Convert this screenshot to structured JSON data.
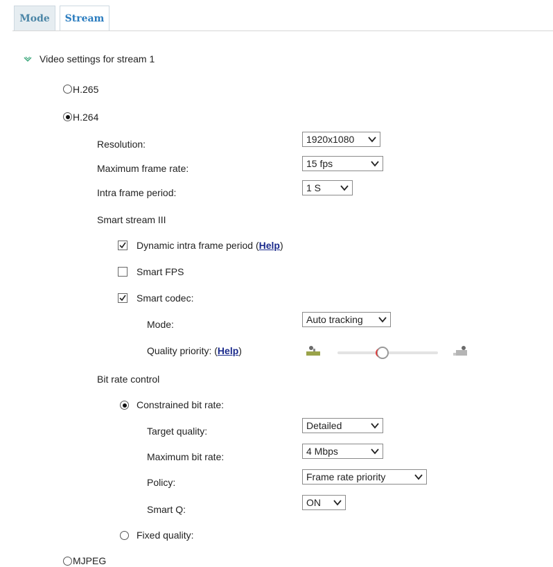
{
  "tabs": [
    {
      "label": "Mode",
      "active": false
    },
    {
      "label": "Stream",
      "active": true
    }
  ],
  "section": {
    "title": "Video settings for stream 1",
    "icon": "expand-chevron-icon"
  },
  "codecs": {
    "h265": {
      "label": "H.265",
      "selected": false
    },
    "h264": {
      "label": "H.264",
      "selected": true
    },
    "mjpeg": {
      "label": "MJPEG",
      "selected": false
    }
  },
  "h264": {
    "resolution": {
      "label": "Resolution:",
      "value": "1920x1080"
    },
    "max_frame_rate": {
      "label": "Maximum frame rate:",
      "value": "15 fps"
    },
    "intra_frame_period": {
      "label": "Intra frame period:",
      "value": "1 S"
    },
    "smart_stream": {
      "title": "Smart stream III",
      "dynamic_intra": {
        "label": "Dynamic intra frame period (",
        "help": "Help",
        "close": ")",
        "checked": true
      },
      "smart_fps": {
        "label": "Smart FPS",
        "checked": false
      },
      "smart_codec": {
        "label": "Smart codec:",
        "checked": true
      },
      "mode": {
        "label": "Mode:",
        "value": "Auto tracking"
      },
      "quality_priority": {
        "label": "Quality priority: (",
        "help": "Help",
        "close": ")",
        "level": 0.45
      }
    },
    "bit_rate_control": {
      "title": "Bit rate control",
      "constrained": {
        "label": "Constrained bit rate:",
        "selected": true
      },
      "target_quality": {
        "label": "Target quality:",
        "value": "Detailed"
      },
      "max_bit_rate": {
        "label": "Maximum bit rate:",
        "value": "4 Mbps"
      },
      "policy": {
        "label": "Policy:",
        "value": "Frame rate priority"
      },
      "smart_q": {
        "label": "Smart Q:",
        "value": "ON"
      },
      "fixed": {
        "label": "Fixed quality:",
        "selected": false
      }
    }
  }
}
